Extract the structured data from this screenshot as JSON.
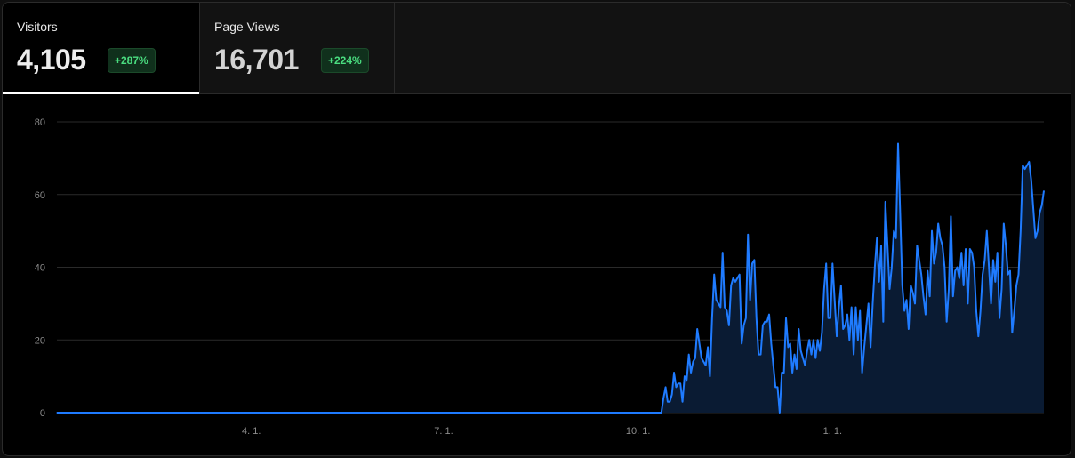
{
  "tabs": [
    {
      "label": "Visitors",
      "value": "4,105",
      "change": "+287%",
      "active": true
    },
    {
      "label": "Page Views",
      "value": "16,701",
      "change": "+224%",
      "active": false
    }
  ],
  "colors": {
    "accent": "#1f7bff",
    "fill": "#0a1b33",
    "badge_text": "#4ade80",
    "grid": "#2a2a2a"
  },
  "chart_data": {
    "type": "area",
    "ylim": [
      0,
      80
    ],
    "y_ticks": [
      0,
      20,
      40,
      60,
      80
    ],
    "x_tick_labels": [
      {
        "label": "4. 1.",
        "index": 92
      },
      {
        "label": "7. 1.",
        "index": 183
      },
      {
        "label": "10. 1.",
        "index": 275
      },
      {
        "label": "1. 1.",
        "index": 367
      }
    ],
    "series": [
      {
        "values": [
          0,
          0,
          0,
          0,
          0,
          0,
          0,
          0,
          0,
          0,
          0,
          0,
          0,
          0,
          0,
          0,
          0,
          0,
          0,
          0,
          0,
          0,
          0,
          0,
          0,
          0,
          0,
          0,
          0,
          0,
          0,
          0,
          0,
          0,
          0,
          0,
          0,
          0,
          0,
          0,
          0,
          0,
          0,
          0,
          0,
          0,
          0,
          0,
          0,
          0,
          0,
          0,
          0,
          0,
          0,
          0,
          0,
          0,
          0,
          0,
          0,
          0,
          0,
          0,
          0,
          0,
          0,
          0,
          0,
          0,
          0,
          0,
          0,
          0,
          0,
          0,
          0,
          0,
          0,
          0,
          0,
          0,
          0,
          0,
          0,
          0,
          0,
          0,
          0,
          0,
          0,
          0,
          0,
          0,
          0,
          0,
          0,
          0,
          0,
          0,
          0,
          0,
          0,
          0,
          0,
          0,
          0,
          0,
          0,
          0,
          0,
          0,
          0,
          0,
          0,
          0,
          0,
          0,
          0,
          0,
          0,
          0,
          0,
          0,
          0,
          0,
          0,
          0,
          0,
          0,
          0,
          0,
          0,
          0,
          0,
          0,
          0,
          0,
          0,
          0,
          0,
          0,
          0,
          0,
          0,
          0,
          0,
          0,
          0,
          0,
          0,
          0,
          0,
          0,
          0,
          0,
          0,
          0,
          0,
          0,
          0,
          0,
          0,
          0,
          0,
          0,
          0,
          0,
          0,
          0,
          0,
          0,
          0,
          0,
          0,
          0,
          0,
          0,
          0,
          0,
          0,
          0,
          0,
          0,
          0,
          0,
          0,
          0,
          0,
          0,
          0,
          0,
          0,
          0,
          0,
          0,
          0,
          0,
          0,
          0,
          0,
          0,
          0,
          0,
          0,
          0,
          0,
          0,
          0,
          0,
          0,
          0,
          0,
          0,
          0,
          0,
          0,
          0,
          0,
          0,
          0,
          0,
          0,
          0,
          0,
          0,
          0,
          0,
          0,
          0,
          0,
          0,
          0,
          0,
          0,
          0,
          0,
          0,
          0,
          0,
          0,
          0,
          0,
          0,
          0,
          0,
          0,
          0,
          0,
          0,
          0,
          0,
          0,
          0,
          0,
          0,
          0,
          0,
          0,
          0,
          0,
          0,
          0,
          0,
          0,
          0,
          0,
          0,
          0,
          0,
          0,
          0,
          0,
          0,
          0,
          0,
          0,
          0,
          0,
          0,
          0,
          0,
          0,
          0,
          0,
          0,
          0,
          4,
          7,
          3,
          3,
          5,
          11,
          7,
          8,
          8,
          3,
          10,
          9,
          16,
          11,
          14,
          15,
          23,
          19,
          15,
          14,
          13,
          18,
          10,
          26,
          38,
          31,
          30,
          29,
          44,
          29,
          28,
          24,
          35,
          37,
          36,
          37,
          38,
          19,
          24,
          26,
          49,
          31,
          41,
          42,
          26,
          16,
          16,
          24,
          25,
          25,
          27,
          19,
          13,
          7,
          7,
          0,
          11,
          11,
          26,
          18,
          19,
          11,
          16,
          12,
          23,
          17,
          15,
          13,
          17,
          20,
          16,
          20,
          15,
          20,
          17,
          22,
          34,
          41,
          26,
          26,
          41,
          31,
          21,
          29,
          35,
          23,
          24,
          27,
          20,
          29,
          16,
          29,
          20,
          28,
          11,
          18,
          24,
          30,
          18,
          30,
          40,
          48,
          36,
          46,
          25,
          58,
          46,
          34,
          40,
          50,
          48,
          74,
          55,
          35,
          28,
          31,
          23,
          35,
          33,
          30,
          46,
          42,
          38,
          32,
          27,
          39,
          32,
          50,
          41,
          44,
          52,
          48,
          46,
          40,
          25,
          34,
          54,
          32,
          39,
          40,
          37,
          44,
          35,
          45,
          30,
          45,
          44,
          40,
          28,
          21,
          28,
          38,
          42,
          50,
          40,
          30,
          42,
          36,
          44,
          26,
          34,
          52,
          46,
          38,
          39,
          22,
          28,
          35,
          38,
          50,
          68,
          67,
          68,
          69,
          64,
          56,
          48,
          50,
          55,
          57,
          61
        ]
      }
    ]
  }
}
